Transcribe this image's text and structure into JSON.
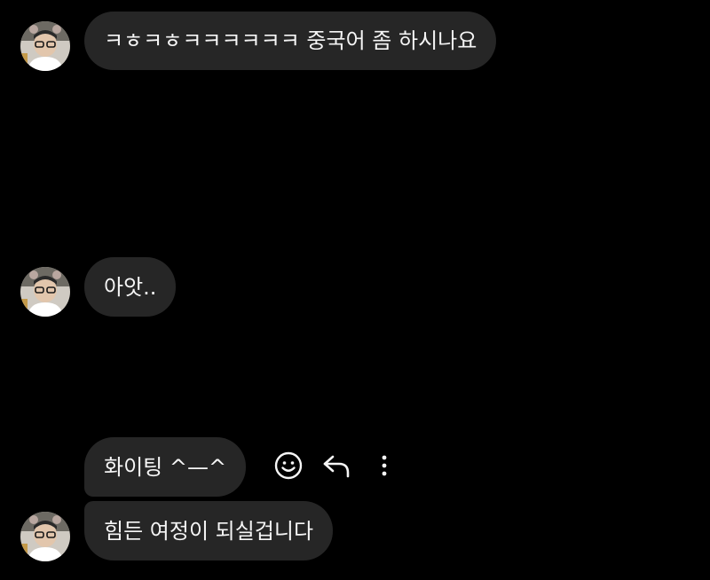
{
  "messages": [
    {
      "text": "ㅋㅎㅋㅎㅋㅋㅋㅋㅋㅋ 중국어 좀 하시나요",
      "show_avatar": true
    },
    {
      "text": "아앗..",
      "show_avatar": true
    },
    {
      "text": "화이팅 ^—^",
      "show_avatar": false
    },
    {
      "text": "힘든 여정이 되실겁니다",
      "show_avatar": true
    }
  ],
  "hover_actions": {
    "icons": [
      "emoji-react-icon",
      "reply-icon",
      "more-options-icon"
    ]
  },
  "colors": {
    "background": "#000000",
    "bubble": "#262626",
    "text": "#f5f5f5",
    "icon": "#f5f5f5"
  }
}
